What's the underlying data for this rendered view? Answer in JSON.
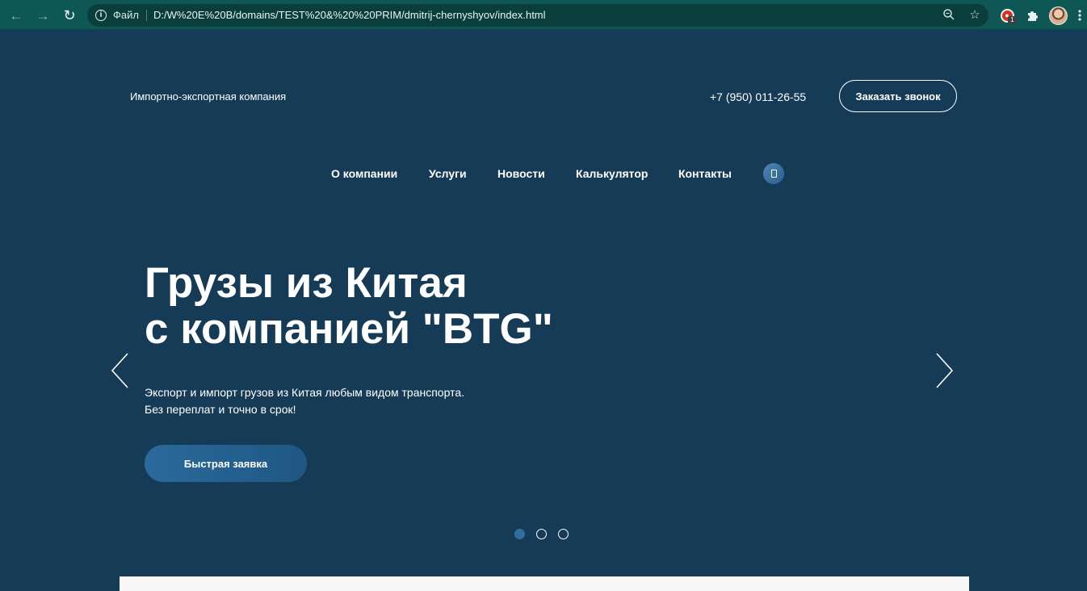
{
  "browser": {
    "scheme_label": "Файл",
    "url": "D:/W%20E%20B/domains/TEST%20&%20%20PRIM/dmitrij-chernyshyov/index.html",
    "extension_badge": "1",
    "icons": [
      "back-arrow-icon",
      "forward-arrow-icon",
      "reload-icon",
      "info-icon",
      "zoom-icon",
      "star-icon",
      "extension-icon",
      "puzzle-icon",
      "profile-avatar",
      "kebab-menu-icon"
    ]
  },
  "header": {
    "tagline": "Импортно-экспортная компания",
    "phone": "+7 (950) 011-26-55",
    "callback_label": "Заказать звонок"
  },
  "nav": {
    "items": [
      {
        "label": "О компании"
      },
      {
        "label": "Услуги"
      },
      {
        "label": "Новости"
      },
      {
        "label": "Калькулятор"
      },
      {
        "label": "Контакты"
      }
    ],
    "search_icon": "search-icon"
  },
  "hero": {
    "title_line1": "Грузы из Китая",
    "title_line2": "с компанией \"BTG\"",
    "desc_line1": "Экспорт и импорт грузов из Китая любым видом транспорта.",
    "desc_line2": "Без переплат и точно в срок!",
    "cta_label": "Быстрая заявка"
  },
  "slider": {
    "slide_count": 3,
    "active_slide": 1
  },
  "colors": {
    "page_bg": "#163b57",
    "browser_bar": "#0f5754",
    "accent": "#2a6a9c",
    "text": "#ffffff"
  }
}
